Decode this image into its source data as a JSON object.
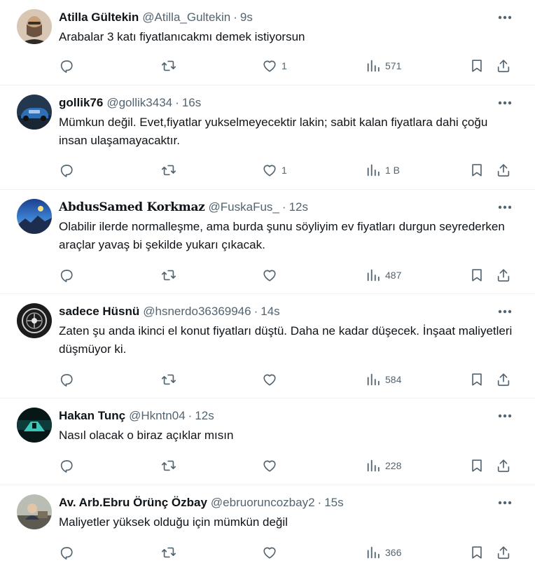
{
  "tweets": [
    {
      "name": "Atilla Gültekin",
      "handle": "@Atilla_Gultekin",
      "dot": "·",
      "time": "9s",
      "text": "Arabalar 3 katı fiyatlanıcakmı demek istiyorsun",
      "likes": "1",
      "views": "571",
      "avatar_color": "#c9a27a"
    },
    {
      "name": "gollik76",
      "handle": "@gollik3434",
      "dot": "·",
      "time": "16s",
      "text": "Mümkun değil. Evet,fiyatlar yukselmeyecektir lakin; sabit kalan fiyatlara dahi çoğu insan ulaşamayacaktır.",
      "likes": "1",
      "views": "1 B",
      "avatar_color": "#1e3a5c"
    },
    {
      "name": "AbdusSamed Korkmaz",
      "handle": "@FuskaFus_",
      "dot": "·",
      "time": "12s",
      "text": "Olabilir ilerde normalleşme, ama burda şunu söyliyim ev fiyatları durgun seyrederken araçlar yavaş bi şekilde yukarı çıkacak.",
      "likes": "",
      "views": "487",
      "avatar_color": "#2f5fb0"
    },
    {
      "name": "sadece Hüsnü",
      "handle": "@hsnerdo36369946",
      "dot": "·",
      "time": "14s",
      "text": "Zaten şu anda ikinci el konut fiyatları düştü. Daha ne kadar düşecek. İnşaat maliyetleri düşmüyor ki.",
      "likes": "",
      "views": "584",
      "avatar_color": "#1a1a1a"
    },
    {
      "name": "Hakan Tunç",
      "handle": "@Hkntn04",
      "dot": "·",
      "time": "12s",
      "text": "Nasıl olacak o biraz açıklar mısın",
      "likes": "",
      "views": "228",
      "avatar_color": "#0b2a2a"
    },
    {
      "name": "Av. Arb.Ebru Örünç Özbay",
      "handle": "@ebruoruncozbay2",
      "dot": "·",
      "time": "15s",
      "text": "Maliyetler yüksek olduğu için mümkün değil",
      "likes": "",
      "views": "366",
      "avatar_color": "#8a8f86"
    }
  ],
  "icons": {
    "reply": "reply-icon",
    "retweet": "retweet-icon",
    "like": "heart-icon",
    "views": "views-chart-icon",
    "bookmark": "bookmark-icon",
    "share": "share-icon",
    "more": "more-dots-icon"
  },
  "colors": {
    "text": "#0f1419",
    "secondary": "#536471",
    "divider": "#eff3f4"
  }
}
